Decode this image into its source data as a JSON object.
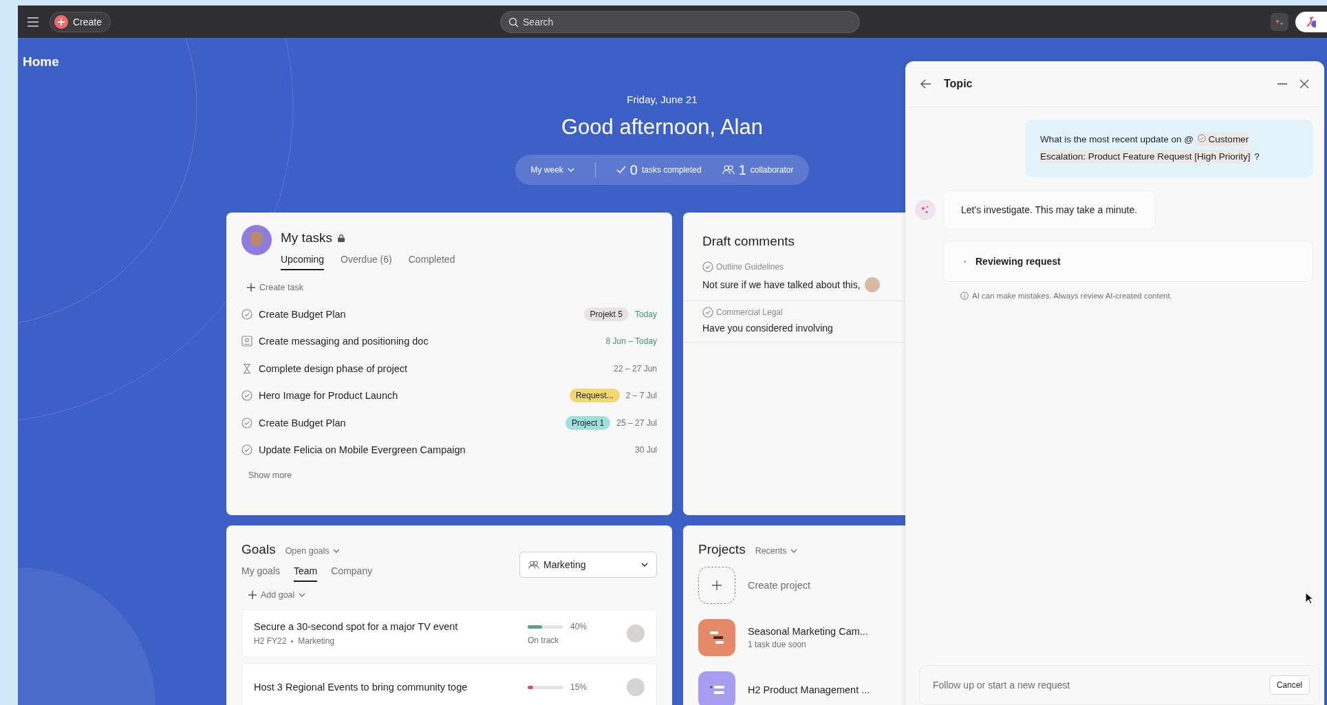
{
  "topbar": {
    "create_label": "Create",
    "search_placeholder": "Search"
  },
  "page_title": "Home",
  "header": {
    "date": "Friday, June 21",
    "greeting": "Good afternoon, Alan",
    "period": "My week",
    "tasks_count": "0",
    "tasks_label": "tasks completed",
    "collaborators_count": "1",
    "collaborators_label": "collaborator"
  },
  "my_tasks": {
    "title": "My tasks",
    "tabs": [
      {
        "label": "Upcoming",
        "selected": true
      },
      {
        "label": "Overdue (6)",
        "selected": false
      },
      {
        "label": "Completed",
        "selected": false
      }
    ],
    "create_task": "Create task",
    "show_more": "Show more",
    "tasks": [
      {
        "kind": "task",
        "name": "Create Budget Plan",
        "tag": {
          "text": "Projekt 5",
          "color": "#e6e4e4"
        },
        "date": "Today",
        "due_soon": true
      },
      {
        "kind": "approval",
        "name": "Create messaging and positioning doc",
        "date": "8 Jun – Today",
        "due_soon": true
      },
      {
        "kind": "milestone",
        "name": "Complete design phase of project",
        "date": "22 – 27 Jun",
        "due_soon": false
      },
      {
        "kind": "task",
        "name": "Hero Image for Product Launch",
        "tag": {
          "text": "Request...",
          "color": "#f1d870"
        },
        "date": "2 – 7 Jul",
        "due_soon": false
      },
      {
        "kind": "task",
        "name": "Create Budget Plan",
        "tag": {
          "text": "Project 1",
          "color": "#9fe0dc"
        },
        "date": "25 – 27 Jul",
        "due_soon": false
      },
      {
        "kind": "task",
        "name": "Update Felicia on Mobile Evergreen Campaign",
        "date": "30 Jul",
        "due_soon": false
      }
    ]
  },
  "draft_comments": {
    "title": "Draft comments",
    "items": [
      {
        "task": "Outline Guidelines",
        "text": "Not sure if we have talked about this,",
        "mention": true
      },
      {
        "task": "Commercial Legal",
        "text": "Have you considered involving",
        "mention": false
      }
    ]
  },
  "goals": {
    "title": "Goals",
    "filter": "Open goals",
    "tabs": [
      {
        "label": "My goals",
        "selected": false
      },
      {
        "label": "Team",
        "selected": true
      },
      {
        "label": "Company",
        "selected": false
      }
    ],
    "team_select": "Marketing",
    "add_goal": "Add goal",
    "items": [
      {
        "name": "Secure a 30-second spot for a major TV event",
        "period": "H2 FY22",
        "team": "Marketing",
        "level": 0.4,
        "percent": "40%",
        "status": "On track",
        "color": "#5da283"
      },
      {
        "name": "Host 3 Regional Events to bring community toge",
        "level": 0.15,
        "percent": "15%",
        "color": "#e8505b"
      }
    ]
  },
  "projects": {
    "title": "Projects",
    "filter": "Recents",
    "create": "Create project",
    "items": [
      {
        "kind": "timeline",
        "name": "Seasonal Marketing Cam...",
        "meta": "1 task due soon",
        "color": "#e48a68"
      },
      {
        "kind": "list",
        "name": "H2 Product Management ...",
        "color": "#a79ef2"
      }
    ]
  },
  "topic_panel": {
    "title": "Topic",
    "question_prefix": "What is the most recent update on @",
    "question_ref": "Customer Escalation: Product Feature Request [High Priority]",
    "question_suffix": "?",
    "reply": "Let's investigate. This may take a minute.",
    "status": "Reviewing request",
    "disclaimer": "AI can make mistakes. Always review AI-created content.",
    "input_placeholder": "Follow up or start a new request",
    "cancel": "Cancel"
  }
}
